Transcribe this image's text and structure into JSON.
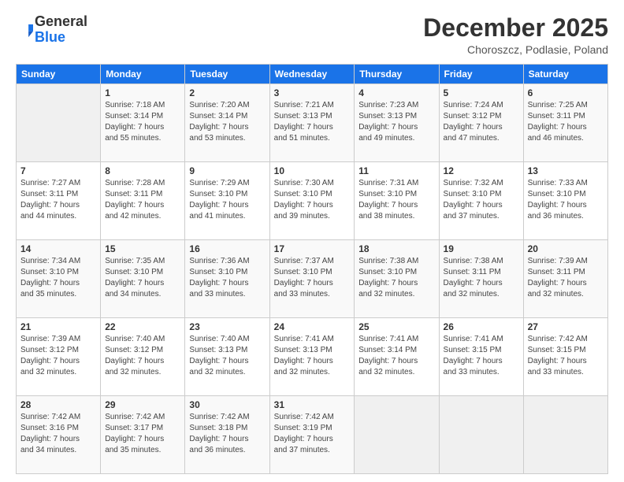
{
  "header": {
    "logo": {
      "line1": "General",
      "line2": "Blue"
    },
    "title": "December 2025",
    "subtitle": "Choroszcz, Podlasie, Poland"
  },
  "days_of_week": [
    "Sunday",
    "Monday",
    "Tuesday",
    "Wednesday",
    "Thursday",
    "Friday",
    "Saturday"
  ],
  "weeks": [
    [
      {
        "day": "",
        "info": ""
      },
      {
        "day": "1",
        "info": "Sunrise: 7:18 AM\nSunset: 3:14 PM\nDaylight: 7 hours\nand 55 minutes."
      },
      {
        "day": "2",
        "info": "Sunrise: 7:20 AM\nSunset: 3:14 PM\nDaylight: 7 hours\nand 53 minutes."
      },
      {
        "day": "3",
        "info": "Sunrise: 7:21 AM\nSunset: 3:13 PM\nDaylight: 7 hours\nand 51 minutes."
      },
      {
        "day": "4",
        "info": "Sunrise: 7:23 AM\nSunset: 3:13 PM\nDaylight: 7 hours\nand 49 minutes."
      },
      {
        "day": "5",
        "info": "Sunrise: 7:24 AM\nSunset: 3:12 PM\nDaylight: 7 hours\nand 47 minutes."
      },
      {
        "day": "6",
        "info": "Sunrise: 7:25 AM\nSunset: 3:11 PM\nDaylight: 7 hours\nand 46 minutes."
      }
    ],
    [
      {
        "day": "7",
        "info": "Sunrise: 7:27 AM\nSunset: 3:11 PM\nDaylight: 7 hours\nand 44 minutes."
      },
      {
        "day": "8",
        "info": "Sunrise: 7:28 AM\nSunset: 3:11 PM\nDaylight: 7 hours\nand 42 minutes."
      },
      {
        "day": "9",
        "info": "Sunrise: 7:29 AM\nSunset: 3:10 PM\nDaylight: 7 hours\nand 41 minutes."
      },
      {
        "day": "10",
        "info": "Sunrise: 7:30 AM\nSunset: 3:10 PM\nDaylight: 7 hours\nand 39 minutes."
      },
      {
        "day": "11",
        "info": "Sunrise: 7:31 AM\nSunset: 3:10 PM\nDaylight: 7 hours\nand 38 minutes."
      },
      {
        "day": "12",
        "info": "Sunrise: 7:32 AM\nSunset: 3:10 PM\nDaylight: 7 hours\nand 37 minutes."
      },
      {
        "day": "13",
        "info": "Sunrise: 7:33 AM\nSunset: 3:10 PM\nDaylight: 7 hours\nand 36 minutes."
      }
    ],
    [
      {
        "day": "14",
        "info": "Sunrise: 7:34 AM\nSunset: 3:10 PM\nDaylight: 7 hours\nand 35 minutes."
      },
      {
        "day": "15",
        "info": "Sunrise: 7:35 AM\nSunset: 3:10 PM\nDaylight: 7 hours\nand 34 minutes."
      },
      {
        "day": "16",
        "info": "Sunrise: 7:36 AM\nSunset: 3:10 PM\nDaylight: 7 hours\nand 33 minutes."
      },
      {
        "day": "17",
        "info": "Sunrise: 7:37 AM\nSunset: 3:10 PM\nDaylight: 7 hours\nand 33 minutes."
      },
      {
        "day": "18",
        "info": "Sunrise: 7:38 AM\nSunset: 3:10 PM\nDaylight: 7 hours\nand 32 minutes."
      },
      {
        "day": "19",
        "info": "Sunrise: 7:38 AM\nSunset: 3:11 PM\nDaylight: 7 hours\nand 32 minutes."
      },
      {
        "day": "20",
        "info": "Sunrise: 7:39 AM\nSunset: 3:11 PM\nDaylight: 7 hours\nand 32 minutes."
      }
    ],
    [
      {
        "day": "21",
        "info": "Sunrise: 7:39 AM\nSunset: 3:12 PM\nDaylight: 7 hours\nand 32 minutes."
      },
      {
        "day": "22",
        "info": "Sunrise: 7:40 AM\nSunset: 3:12 PM\nDaylight: 7 hours\nand 32 minutes."
      },
      {
        "day": "23",
        "info": "Sunrise: 7:40 AM\nSunset: 3:13 PM\nDaylight: 7 hours\nand 32 minutes."
      },
      {
        "day": "24",
        "info": "Sunrise: 7:41 AM\nSunset: 3:13 PM\nDaylight: 7 hours\nand 32 minutes."
      },
      {
        "day": "25",
        "info": "Sunrise: 7:41 AM\nSunset: 3:14 PM\nDaylight: 7 hours\nand 32 minutes."
      },
      {
        "day": "26",
        "info": "Sunrise: 7:41 AM\nSunset: 3:15 PM\nDaylight: 7 hours\nand 33 minutes."
      },
      {
        "day": "27",
        "info": "Sunrise: 7:42 AM\nSunset: 3:15 PM\nDaylight: 7 hours\nand 33 minutes."
      }
    ],
    [
      {
        "day": "28",
        "info": "Sunrise: 7:42 AM\nSunset: 3:16 PM\nDaylight: 7 hours\nand 34 minutes."
      },
      {
        "day": "29",
        "info": "Sunrise: 7:42 AM\nSunset: 3:17 PM\nDaylight: 7 hours\nand 35 minutes."
      },
      {
        "day": "30",
        "info": "Sunrise: 7:42 AM\nSunset: 3:18 PM\nDaylight: 7 hours\nand 36 minutes."
      },
      {
        "day": "31",
        "info": "Sunrise: 7:42 AM\nSunset: 3:19 PM\nDaylight: 7 hours\nand 37 minutes."
      },
      {
        "day": "",
        "info": ""
      },
      {
        "day": "",
        "info": ""
      },
      {
        "day": "",
        "info": ""
      }
    ]
  ]
}
